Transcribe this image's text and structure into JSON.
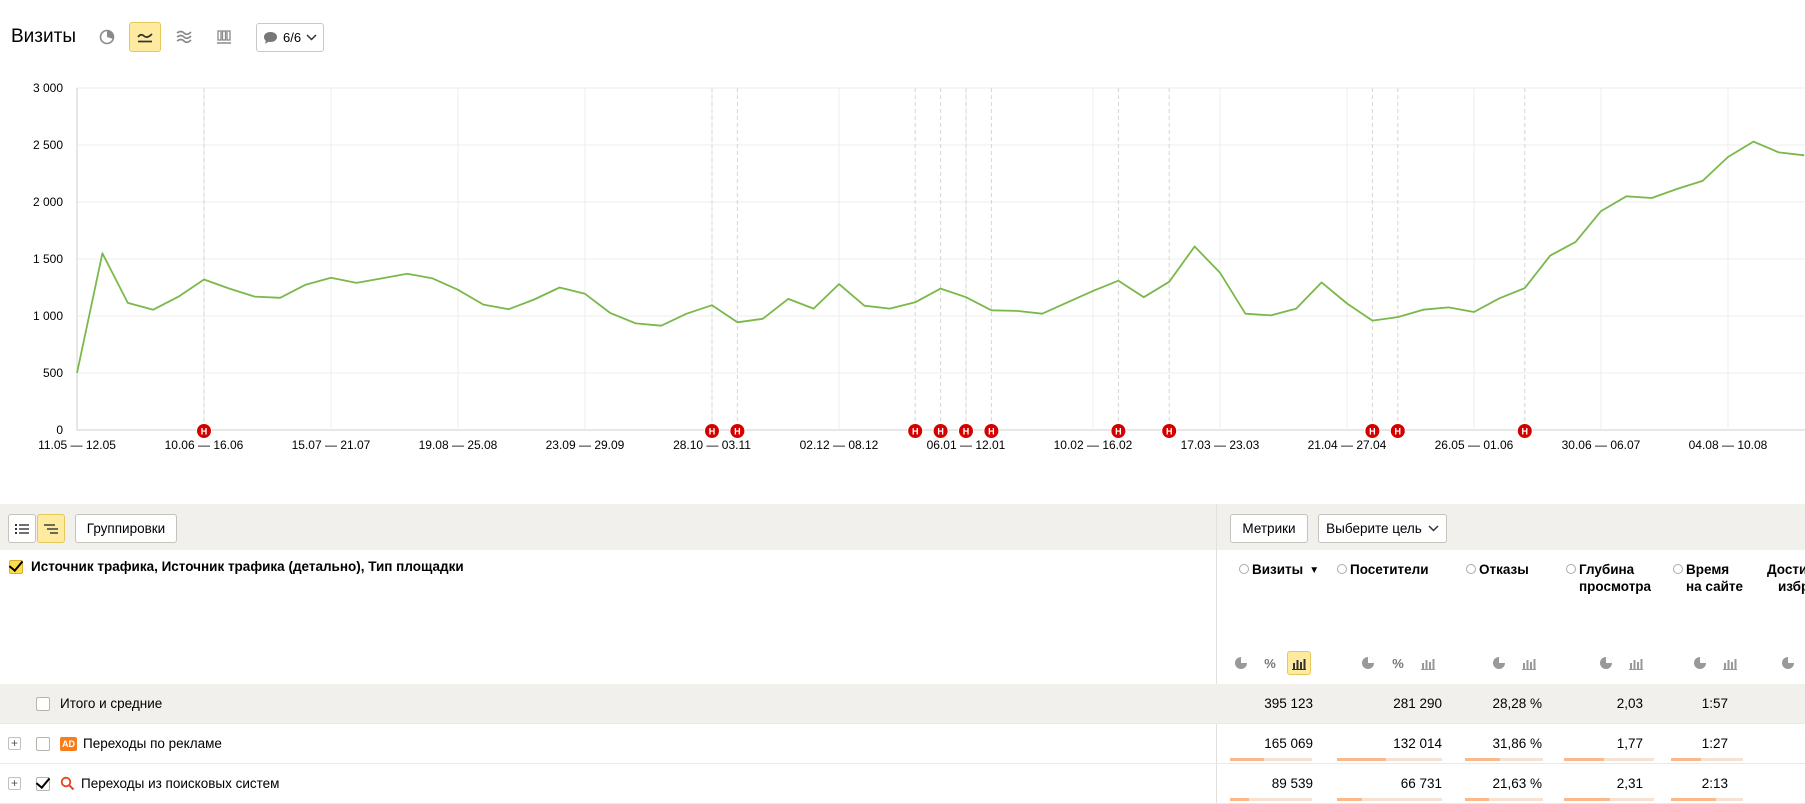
{
  "header": {
    "title": "Визиты",
    "notes_count": "6/6"
  },
  "chart_data": {
    "type": "line",
    "ylim": [
      0,
      3000
    ],
    "y_ticks": [
      "3 000",
      "2 500",
      "2 000",
      "1 500",
      "1 000",
      "500",
      "0"
    ],
    "x_tick_labels": [
      "11.05 — 12.05",
      "10.06 — 16.06",
      "15.07 — 21.07",
      "19.08 — 25.08",
      "23.09 — 29.09",
      "28.10 — 03.11",
      "02.12 — 08.12",
      "06.01 — 12.01",
      "10.02 — 16.02",
      "17.03 — 23.03",
      "21.04 — 27.04",
      "26.05 — 01.06",
      "30.06 — 06.07",
      "04.08 — 10.08"
    ],
    "series": [
      {
        "color": "#7ab84a",
        "values": [
          500,
          1550,
          1115,
          1055,
          1170,
          1320,
          1240,
          1170,
          1160,
          1275,
          1335,
          1290,
          1330,
          1370,
          1330,
          1230,
          1100,
          1060,
          1145,
          1250,
          1195,
          1025,
          935,
          915,
          1020,
          1095,
          945,
          975,
          1150,
          1065,
          1280,
          1090,
          1065,
          1120,
          1240,
          1165,
          1050,
          1045,
          1020,
          1120,
          1220,
          1310,
          1165,
          1300,
          1610,
          1380,
          1020,
          1005,
          1065,
          1295,
          1110,
          960,
          990,
          1055,
          1075,
          1035,
          1155,
          1245,
          1530,
          1650,
          1920,
          2050,
          2035,
          2115,
          2185,
          2395,
          2530,
          2435,
          2410
        ]
      }
    ],
    "annotation_marker": "Н",
    "grid": true,
    "legend": "none"
  },
  "toolbar": {
    "groupings_label": "Группировки",
    "metrics_label": "Метрики",
    "goal_label": "Выберите цель"
  },
  "table": {
    "dimension_header": "Источник трафика, Источник трафика (детально), Тип площадки",
    "columns": [
      {
        "label_line1": "Визиты",
        "label_line2": "",
        "sort": "▼"
      },
      {
        "label_line1": "Посетители",
        "label_line2": ""
      },
      {
        "label_line1": "Отказы",
        "label_line2": ""
      },
      {
        "label_line1": "Глубина",
        "label_line2": "просмотра"
      },
      {
        "label_line1": "Время",
        "label_line2": "на сайте"
      },
      {
        "label_line1": "Дости",
        "label_line2": "избр"
      }
    ],
    "rows": [
      {
        "label": "Итого и средние",
        "values": [
          "395 123",
          "281 290",
          "28,28 %",
          "2,03",
          "1:57"
        ],
        "bars": [],
        "percent_symbol": "%"
      },
      {
        "label": "Переходы по рекламе",
        "badge": "AD",
        "values": [
          "165 069",
          "132 014",
          "31,86 %",
          "1,77",
          "1:27"
        ],
        "bars": [
          0.42,
          0.47,
          0.45,
          0.44,
          0.41
        ]
      },
      {
        "label": "Переходы из поисковых систем",
        "values": [
          "89 539",
          "66 731",
          "21,63 %",
          "2,31",
          "2:13"
        ],
        "bars": [
          0.23,
          0.24,
          0.31,
          0.51,
          0.63
        ]
      }
    ]
  }
}
